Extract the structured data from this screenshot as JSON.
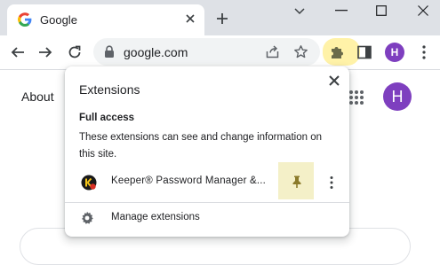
{
  "tab": {
    "title": "Google"
  },
  "omnibox": {
    "url": "google.com"
  },
  "profile": {
    "initial": "H"
  },
  "page": {
    "about_link": "About",
    "avatar_initial": "H"
  },
  "extensions_popup": {
    "title": "Extensions",
    "access_heading": "Full access",
    "access_description": "These extensions can see and change information on this site.",
    "extensions": [
      {
        "name": "Keeper® Password Manager &...",
        "icon": "keeper-icon",
        "pinned": false
      }
    ],
    "manage_label": "Manage extensions"
  },
  "colors": {
    "tabstrip_bg": "#dee1e6",
    "highlight": "#fff2a8",
    "avatar": "#7e3fbf",
    "omnibox_bg": "#f1f3f4"
  }
}
